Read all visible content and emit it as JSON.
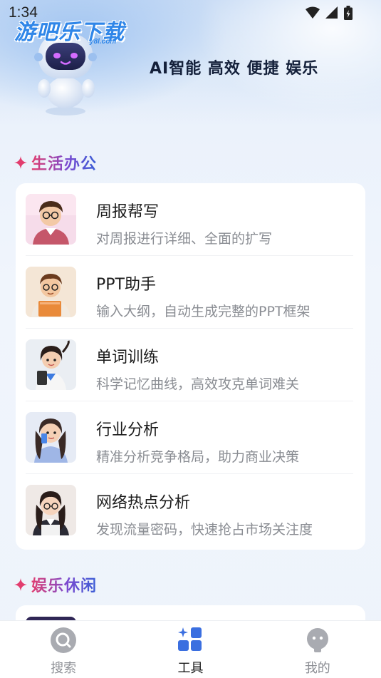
{
  "status_bar": {
    "time": "1:34"
  },
  "brand": {
    "logo_text": "游吧乐下载",
    "logo_sub": "y8l.com",
    "slogan": "AI智能 高效 便捷 娱乐"
  },
  "sections": [
    {
      "title": "生活办公",
      "tools": [
        {
          "name": "周报帮写",
          "desc": "对周报进行详细、全面的扩写",
          "avatar_icon": "boy-glasses-avatar"
        },
        {
          "name": "PPT助手",
          "desc": "输入大纲，自动生成完整的PPT框架",
          "avatar_icon": "boy-book-avatar"
        },
        {
          "name": "单词训练",
          "desc": "科学记忆曲线，高效攻克单词难关",
          "avatar_icon": "girl-tablet-avatar"
        },
        {
          "name": "行业分析",
          "desc": "精准分析竞争格局，助力商业决策",
          "avatar_icon": "girl-phone-avatar"
        },
        {
          "name": "网络热点分析",
          "desc": "发现流量密码，快速抢占市场关注度",
          "avatar_icon": "girl-glasses-avatar"
        }
      ]
    },
    {
      "title": "娱乐休闲",
      "tools": []
    }
  ],
  "bottom_nav": [
    {
      "label": "搜索",
      "icon": "search-icon",
      "active": false
    },
    {
      "label": "工具",
      "icon": "tools-grid-icon",
      "active": true
    },
    {
      "label": "我的",
      "icon": "profile-icon",
      "active": false
    }
  ],
  "colors": {
    "accent": "#3b6fe0",
    "section_title_start": "#e23d6e",
    "section_title_end": "#3a5fd6",
    "inactive_icon": "#a9abb1"
  }
}
